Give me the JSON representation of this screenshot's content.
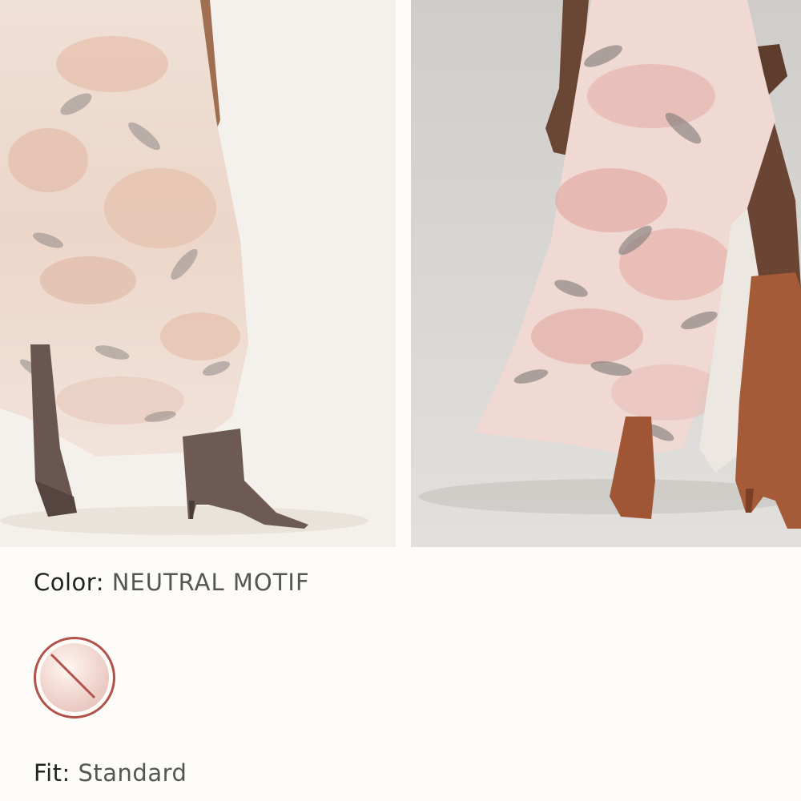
{
  "gallery": {
    "images": [
      {
        "alt": "Model wearing neutral motif maxi dress with brown boots, front view"
      },
      {
        "alt": "Model wearing neutral motif maxi dress with tan boots, side view"
      }
    ]
  },
  "color": {
    "label": "Color:",
    "value": "NEUTRAL MOTIF"
  },
  "swatch": {
    "name": "Neutral Motif",
    "status": "unavailable",
    "accent": "#b0514a"
  },
  "fit": {
    "label": "Fit:",
    "value": "Standard"
  }
}
